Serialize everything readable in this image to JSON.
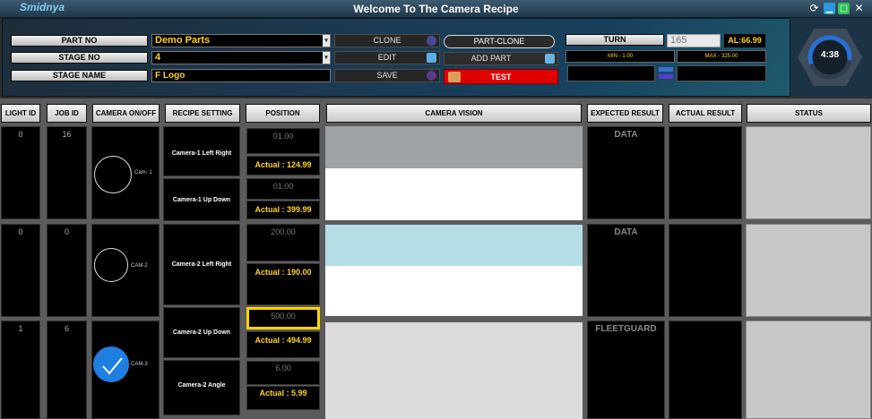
{
  "window": {
    "brand": "Smidnya",
    "title": "Welcome To The Camera Recipe"
  },
  "form": {
    "part_no_label": "PART NO",
    "part_no_value": "Demo Parts",
    "stage_no_label": "STAGE NO",
    "stage_no_value": "4",
    "stage_name_label": "STAGE NAME",
    "stage_name_value": "F Logo"
  },
  "actions": {
    "clone": "CLONE",
    "edit": "EDIT",
    "save": "SAVE",
    "part_clone": "PART-CLONE",
    "add_part": "ADD PART",
    "test": "TEST"
  },
  "turn": {
    "label": "TURN",
    "value": "165",
    "al_value": "AL:66.99",
    "min": "MIN - 1.00",
    "max": "MAX - 325.00"
  },
  "timer": {
    "time": "4:38"
  },
  "table": {
    "headers": {
      "light_id": "LIGHT ID",
      "job_id": "JOB ID",
      "camera_onoff": "CAMERA ON/OFF",
      "recipe_setting": "RECIPE SETTING",
      "position": "POSITION",
      "camera_vision": "CAMERA VISION",
      "expected_result": "EXPECTED RESULT",
      "actual_result": "ACTUAL RESULT",
      "status": "STATUS"
    },
    "groups": [
      {
        "light_id": "0",
        "job_id": "16",
        "camera": "Cam- 1",
        "checked": false,
        "expected": "DATA"
      },
      {
        "light_id": "0",
        "job_id": "0",
        "camera": "CAM-2",
        "checked": false,
        "expected": "DATA"
      },
      {
        "light_id": "1",
        "job_id": "6",
        "camera": "CAM-3",
        "checked": true,
        "expected": "FLEETGUARD"
      }
    ],
    "recipes": [
      {
        "name": "Camera-1 Left Right",
        "position": "01.00",
        "actual": "Actual : 124.99"
      },
      {
        "name": "Camera-1 Up Down",
        "position": "01.00",
        "actual": "Actual : 399.99"
      },
      {
        "name": "Camera-2 Left Right",
        "position": "200.00",
        "actual": "Actual : 190.00"
      },
      {
        "name": "Camera-2 Up Down",
        "position": "500.00",
        "actual": "Actual : 494.99"
      },
      {
        "name": "Camera-2 Angle",
        "position": "6.00",
        "actual": "Actual : 5.99"
      }
    ]
  },
  "colors": {
    "accent_yellow": "#ffd21a",
    "test_red": "#e00000",
    "check_blue": "#1e7fe0",
    "vision_cyan": "#b4dee6"
  }
}
